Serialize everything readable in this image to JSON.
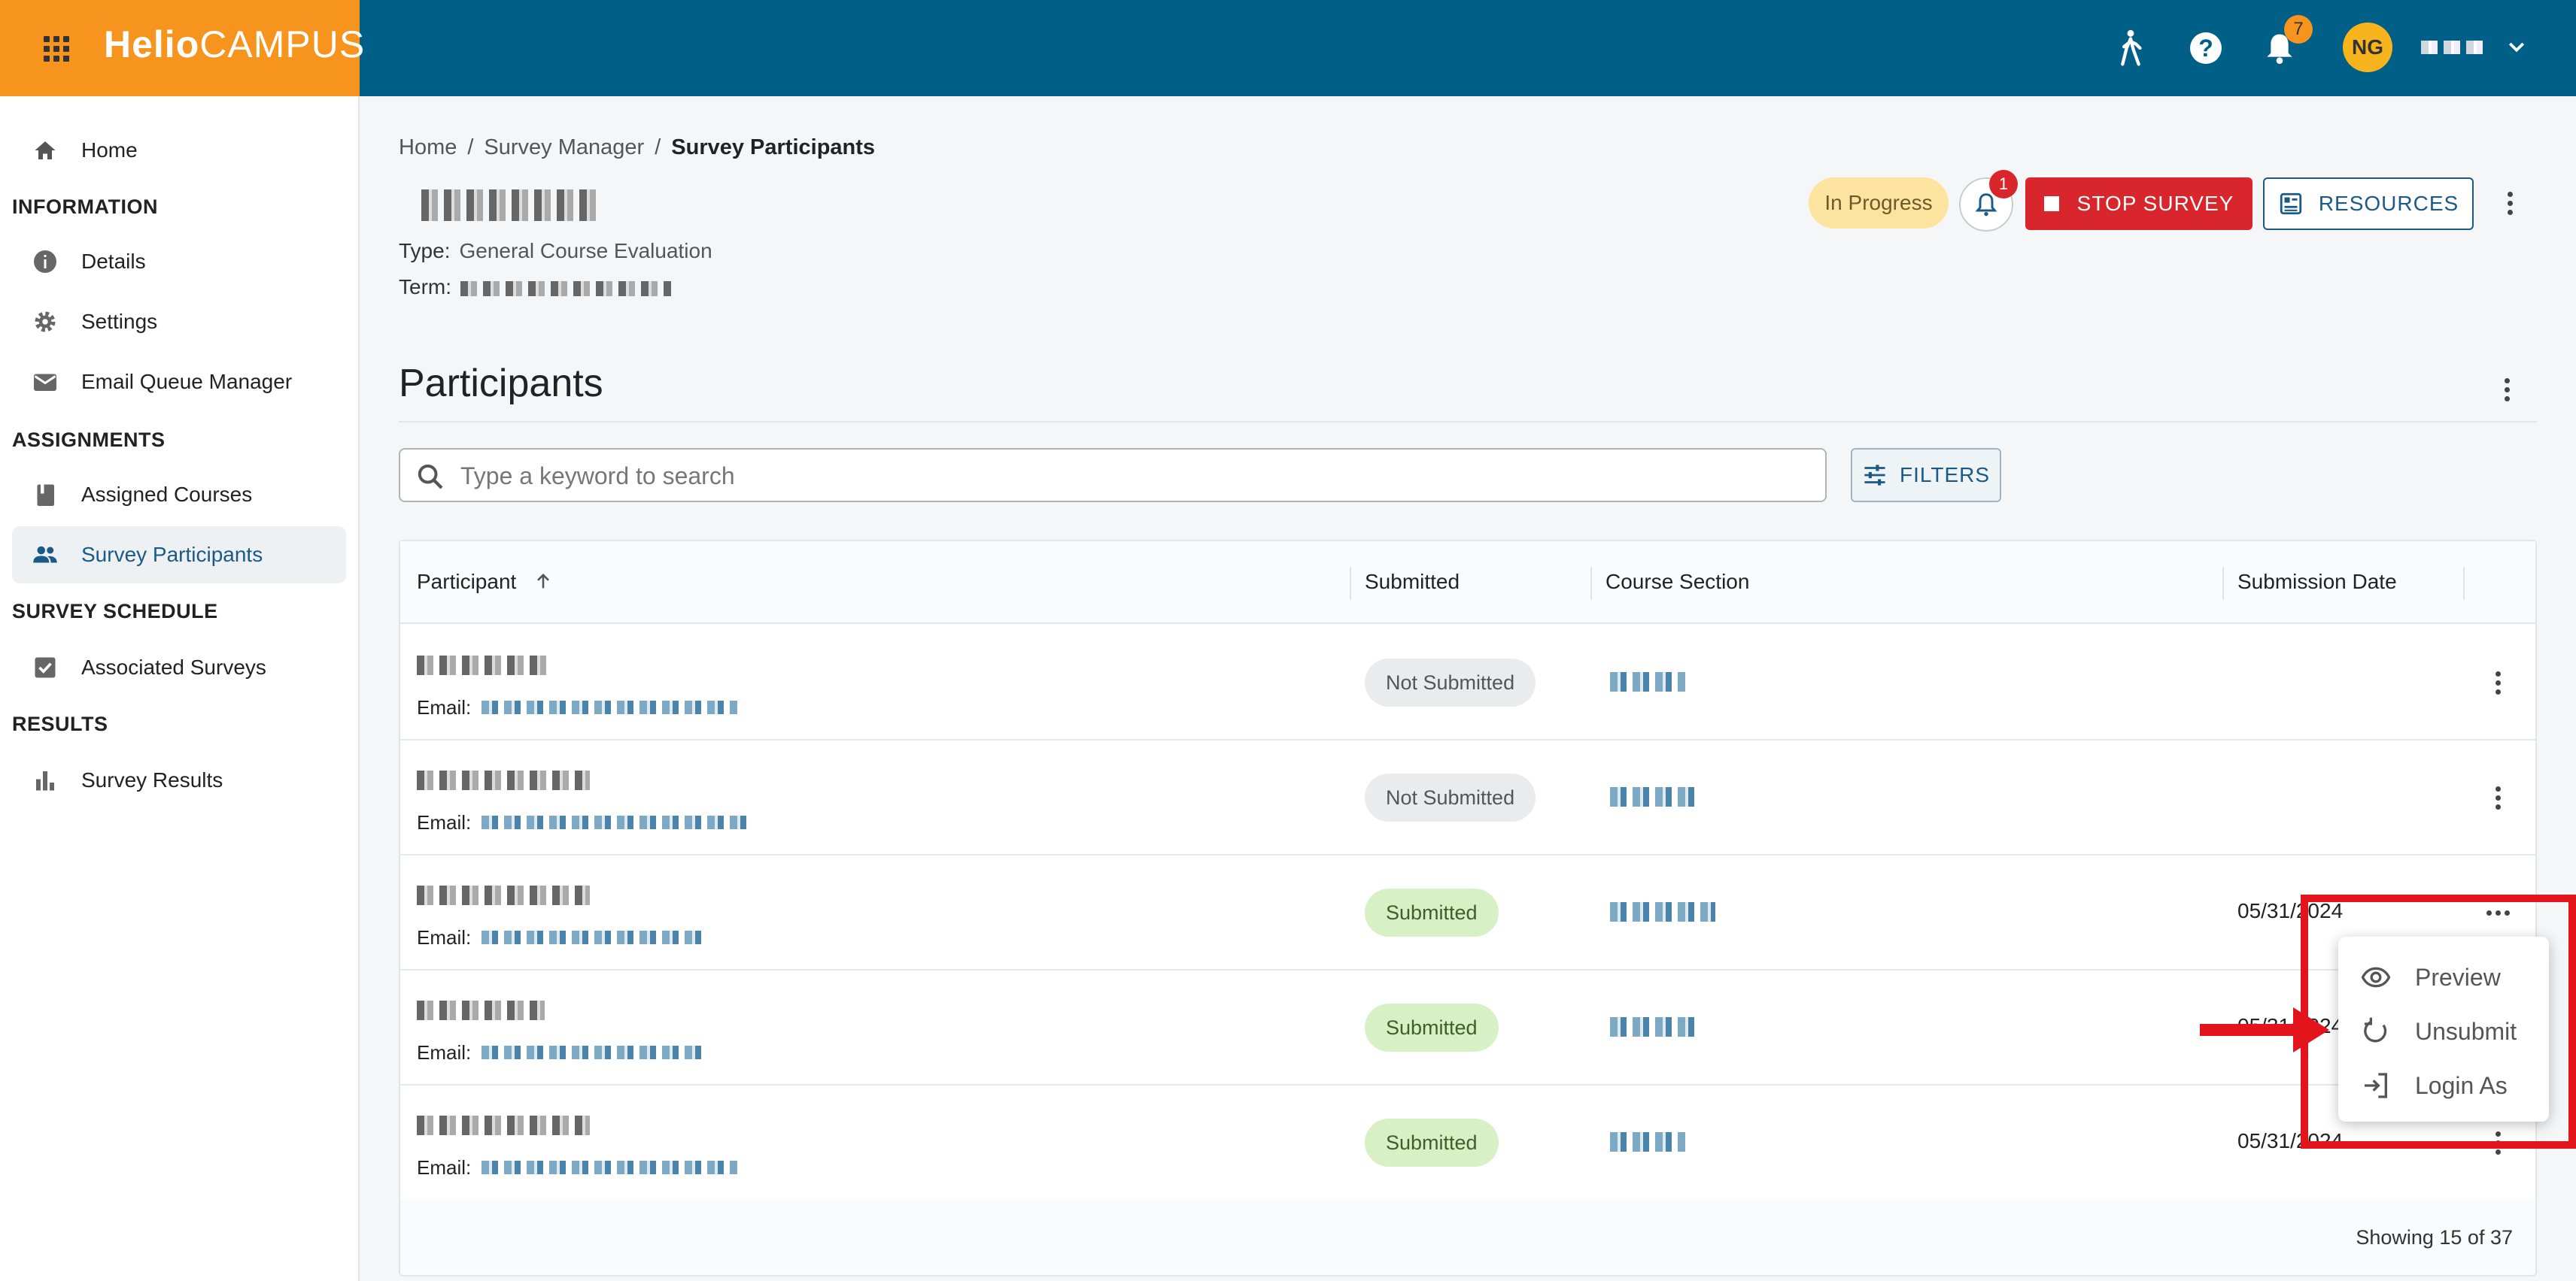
{
  "brand": {
    "logo_bold": "Helio",
    "logo_light": "CAMPUS"
  },
  "topbar": {
    "notification_count": "7",
    "user_initials": "NG"
  },
  "sidebar": {
    "home": "Home",
    "information_heading": "INFORMATION",
    "details": "Details",
    "settings": "Settings",
    "email_queue": "Email Queue Manager",
    "assignments_heading": "ASSIGNMENTS",
    "assigned_courses": "Assigned Courses",
    "survey_participants": "Survey Participants",
    "schedule_heading": "SURVEY SCHEDULE",
    "associated_surveys": "Associated Surveys",
    "results_heading": "RESULTS",
    "survey_results": "Survey Results"
  },
  "breadcrumb": {
    "home": "Home",
    "survey_manager": "Survey Manager",
    "current": "Survey Participants",
    "separator": "/"
  },
  "survey": {
    "type_label": "Type:",
    "type_value": "General Course Evaluation",
    "term_label": "Term:",
    "status": "In Progress",
    "alert_count": "1",
    "stop_label": "STOP SURVEY",
    "resources_label": "RESOURCES"
  },
  "participants": {
    "title": "Participants",
    "search_placeholder": "Type a keyword to search",
    "filters_label": "FILTERS",
    "columns": {
      "participant": "Participant",
      "submitted": "Submitted",
      "course_section": "Course Section",
      "submission_date": "Submission Date"
    },
    "email_label": "Email:",
    "rows": [
      {
        "status": "Not Submitted",
        "date": ""
      },
      {
        "status": "Not Submitted",
        "date": ""
      },
      {
        "status": "Submitted",
        "date": "05/31/2024"
      },
      {
        "status": "Submitted",
        "date": "05/31/2024"
      },
      {
        "status": "Submitted",
        "date": "05/31/2024"
      }
    ],
    "showing": "Showing 15 of 37"
  },
  "row_menu": {
    "preview": "Preview",
    "unsubmit": "Unsubmit",
    "login_as": "Login As"
  },
  "colors": {
    "topbar": "#005f87",
    "brand": "#f7941d",
    "stop": "#d9262c",
    "annotation": "#e3141c"
  }
}
